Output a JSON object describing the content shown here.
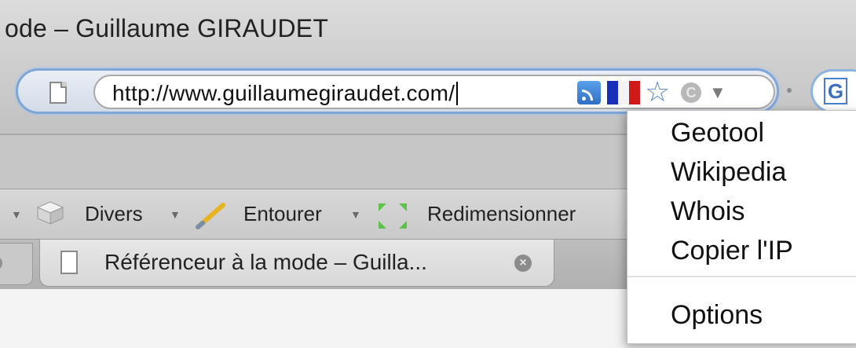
{
  "window": {
    "title": "ode – Guillaume GIRAUDET"
  },
  "navbar": {
    "url": "http://www.guillaumegiraudet.com/",
    "search_engine_glyph": "G"
  },
  "ext_toolbar": {
    "items": [
      {
        "label": "Divers",
        "icon": "cube-icon"
      },
      {
        "label": "Entourer",
        "icon": "pencil-icon"
      },
      {
        "label": "Redimensionner",
        "icon": "resize-icon"
      }
    ]
  },
  "tabs": {
    "active_label": "Référenceur à la mode – Guilla..."
  },
  "menu": {
    "items": [
      "Geotool",
      "Wikipedia",
      "Whois",
      "Copier l'IP"
    ],
    "options_label": "Options"
  },
  "icons": {
    "rss": "rss-feed-icon",
    "flag": "france-flag-icon",
    "star": "bookmark-star-icon",
    "c": "c-circle-icon",
    "dropdown": "chevron-down-icon"
  },
  "colors": {
    "focus_ring": "#7fa6d8",
    "flag_blue": "#1a2fb8",
    "flag_red": "#d41818"
  }
}
